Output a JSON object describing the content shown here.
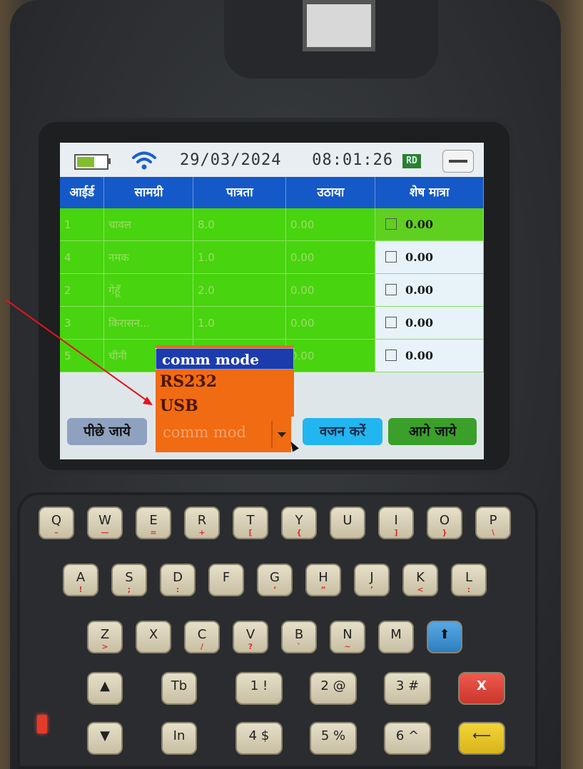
{
  "status": {
    "date": "29/03/2024",
    "time": "08:01:26",
    "badge": "RD",
    "battery_level": 0.6
  },
  "table": {
    "headers": [
      "आईर्ड",
      "सामग्री",
      "पात्रता",
      "उठाया",
      "शेष मात्रा"
    ],
    "rows": [
      {
        "id": "1",
        "item": "चावल",
        "eligible": "8.0",
        "lifted": "0.00",
        "remaining": "0.00"
      },
      {
        "id": "4",
        "item": "नमक",
        "eligible": "1.0",
        "lifted": "0.00",
        "remaining": "0.00"
      },
      {
        "id": "2",
        "item": "गेहूँ",
        "eligible": "2.0",
        "lifted": "0.00",
        "remaining": "0.00"
      },
      {
        "id": "3",
        "item": "किरासन...",
        "eligible": "1.0",
        "lifted": "0.00",
        "remaining": "0.00"
      },
      {
        "id": "5",
        "item": "चीनी",
        "eligible": "",
        "lifted": "0.00",
        "remaining": "0.00"
      }
    ]
  },
  "dropdown": {
    "header": "comm mode",
    "options": [
      "RS232",
      "USB"
    ],
    "current_value": "comm mod"
  },
  "buttons": {
    "back": "पीछे जाये",
    "weigh": "वजन करें",
    "next": "आगे जाये"
  },
  "keypad": {
    "row1": [
      {
        "key": "Q",
        "sub": "–"
      },
      {
        "key": "W",
        "sub": "—"
      },
      {
        "key": "E",
        "sub": "="
      },
      {
        "key": "R",
        "sub": "+"
      },
      {
        "key": "T",
        "sub": "["
      },
      {
        "key": "Y",
        "sub": "{"
      },
      {
        "key": "U",
        "sub": ""
      },
      {
        "key": "I",
        "sub": "]"
      },
      {
        "key": "O",
        "sub": "}"
      },
      {
        "key": "P",
        "sub": "\\"
      }
    ],
    "row2": [
      {
        "key": "A",
        "sub": "!"
      },
      {
        "key": "S",
        "sub": ";"
      },
      {
        "key": "D",
        "sub": ":"
      },
      {
        "key": "F",
        "sub": ""
      },
      {
        "key": "G",
        "sub": "‘"
      },
      {
        "key": "H",
        "sub": "“"
      },
      {
        "key": "J",
        "sub": "’"
      },
      {
        "key": "K",
        "sub": "<"
      },
      {
        "key": "L",
        "sub": ":"
      }
    ],
    "row3": [
      {
        "key": "Z",
        "sub": ">"
      },
      {
        "key": "X",
        "sub": ""
      },
      {
        "key": "C",
        "sub": "/"
      },
      {
        "key": "V",
        "sub": "?"
      },
      {
        "key": "B",
        "sub": "`"
      },
      {
        "key": "N",
        "sub": "~"
      },
      {
        "key": "M",
        "sub": ""
      },
      {
        "key": "⬆",
        "sub": ""
      }
    ],
    "row4": [
      {
        "key": "▲",
        "sub": ""
      },
      {
        "key": "Tb",
        "sub": ""
      },
      {
        "key": "1 !",
        "sub": ""
      },
      {
        "key": "2 @",
        "sub": ""
      },
      {
        "key": "3 #",
        "sub": ""
      },
      {
        "key": "X",
        "sub": ""
      }
    ],
    "row5": [
      {
        "key": "▼",
        "sub": ""
      },
      {
        "key": "In",
        "sub": ""
      },
      {
        "key": "4 $",
        "sub": ""
      },
      {
        "key": "5 %",
        "sub": ""
      },
      {
        "key": "6 ^",
        "sub": ""
      },
      {
        "key": "⟵",
        "sub": ""
      }
    ]
  },
  "colors": {
    "header_blue": "#1558c8",
    "row_green": "#48d40f",
    "dropdown_orange": "#f06b12",
    "annotation_red": "#e0141e"
  }
}
